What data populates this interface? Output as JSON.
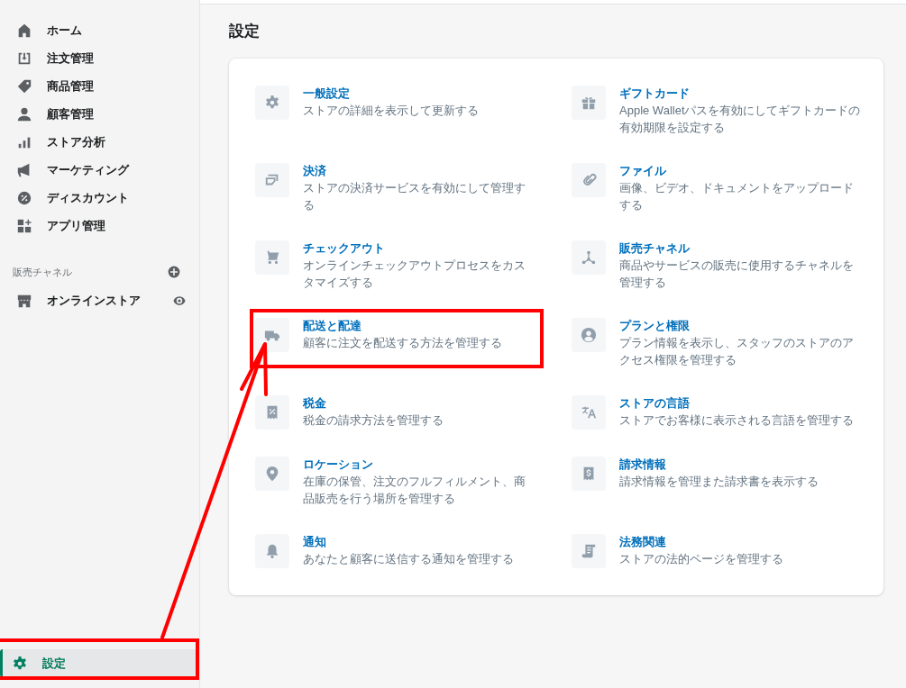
{
  "sidebar": {
    "items": [
      {
        "label": "ホーム",
        "selected": false
      },
      {
        "label": "注文管理",
        "selected": false
      },
      {
        "label": "商品管理",
        "selected": false
      },
      {
        "label": "顧客管理",
        "selected": false
      },
      {
        "label": "ストア分析",
        "selected": false
      },
      {
        "label": "マーケティング",
        "selected": false
      },
      {
        "label": "ディスカウント",
        "selected": false
      },
      {
        "label": "アプリ管理",
        "selected": false
      }
    ],
    "channels_heading": "販売チャネル",
    "channels": [
      {
        "label": "オンラインストア",
        "selected": false
      }
    ],
    "settings_item": {
      "label": "設定",
      "selected": true,
      "highlighted": true
    }
  },
  "page_title": "設定",
  "settings": [
    {
      "title": "一般設定",
      "description": "ストアの詳細を表示して更新する",
      "highlighted": false
    },
    {
      "title": "ギフトカード",
      "description": "Apple Walletパスを有効にしてギフトカードの有効期限を設定する",
      "highlighted": false
    },
    {
      "title": "決済",
      "description": "ストアの決済サービスを有効にして管理する",
      "highlighted": false
    },
    {
      "title": "ファイル",
      "description": "画像、ビデオ、ドキュメントをアップロードする",
      "highlighted": false
    },
    {
      "title": "チェックアウト",
      "description": "オンラインチェックアウトプロセスをカスタマイズする",
      "highlighted": false
    },
    {
      "title": "販売チャネル",
      "description": "商品やサービスの販売に使用するチャネルを管理する",
      "highlighted": false
    },
    {
      "title": "配送と配達",
      "description": "顧客に注文を配送する方法を管理する",
      "highlighted": true
    },
    {
      "title": "プランと権限",
      "description": "プラン情報を表示し、スタッフのストアのアクセス権限を管理する",
      "highlighted": false
    },
    {
      "title": "税金",
      "description": "税金の請求方法を管理する",
      "highlighted": false
    },
    {
      "title": "ストアの言語",
      "description": "ストアでお客様に表示される言語を管理する",
      "highlighted": false
    },
    {
      "title": "ロケーション",
      "description": "在庫の保管、注文のフルフィルメント、商品販売を行う場所を管理する",
      "highlighted": false
    },
    {
      "title": "請求情報",
      "description": "請求情報を管理また請求書を表示する",
      "highlighted": false
    },
    {
      "title": "通知",
      "description": "あなたと顧客に送信する通知を管理する",
      "highlighted": false
    },
    {
      "title": "法務関連",
      "description": "ストアの法的ページを管理する",
      "highlighted": false
    }
  ],
  "annotation_arrow": true
}
